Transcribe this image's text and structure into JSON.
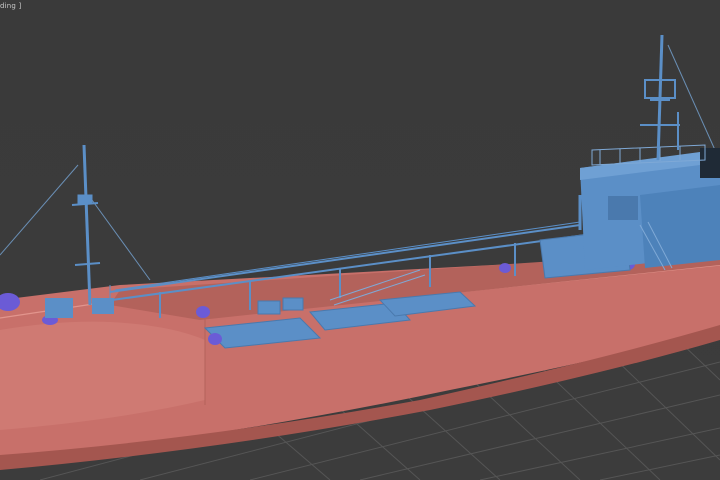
{
  "viewport": {
    "label": "ding ]",
    "mode": "perspective",
    "shading": "default-shading"
  },
  "scene": {
    "model": "oil-tanker",
    "hull_color": "#c8706a",
    "hull_dark_color": "#8f4b46",
    "superstructure_color": "#5b8fc7",
    "equipment_color": "#6b5bd6",
    "grid_color": "#545454",
    "background_color": "#3b3b3b"
  }
}
